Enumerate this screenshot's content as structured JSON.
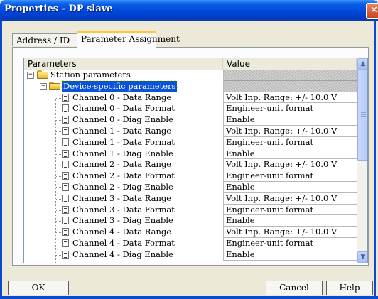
{
  "window": {
    "title": "Properties - DP slave"
  },
  "tabs": [
    {
      "label": "Address / ID",
      "active": false
    },
    {
      "label": "Parameter Assignment",
      "active": true
    }
  ],
  "grid": {
    "col_parameters": "Parameters",
    "col_value": "Value",
    "station_row": {
      "label": "Station parameters",
      "value": ""
    },
    "device_row": {
      "label": "Device-specific parameters",
      "value": ""
    },
    "rows": [
      {
        "label": "Channel 0 - Data Range",
        "value": "Volt Inp. Range: +/- 10.0 V"
      },
      {
        "label": "Channel 0 - Data Format",
        "value": "Engineer-unit format"
      },
      {
        "label": "Channel 0 - Diag Enable",
        "value": "Enable"
      },
      {
        "label": "Channel 1 - Data Range",
        "value": "Volt Inp. Range: +/- 10.0 V"
      },
      {
        "label": "Channel 1 - Data Format",
        "value": "Engineer-unit format"
      },
      {
        "label": "Channel 1 - Diag Enable",
        "value": "Enable"
      },
      {
        "label": "Channel 2 - Data Range",
        "value": "Volt Inp. Range: +/- 10.0 V"
      },
      {
        "label": "Channel 2 - Data Format",
        "value": "Engineer-unit format"
      },
      {
        "label": "Channel 2 - Diag Enable",
        "value": "Enable"
      },
      {
        "label": "Channel 3 - Data Range",
        "value": "Volt Inp. Range: +/- 10.0 V"
      },
      {
        "label": "Channel 3 - Data Format",
        "value": "Engineer-unit format"
      },
      {
        "label": "Channel 3 - Diag Enable",
        "value": "Enable"
      },
      {
        "label": "Channel 4 - Data Range",
        "value": "Volt Inp. Range: +/- 10.0 V"
      },
      {
        "label": "Channel 4 - Data Format",
        "value": "Engineer-unit format"
      },
      {
        "label": "Channel 4 - Diag Enable",
        "value": "Enable"
      }
    ]
  },
  "buttons": {
    "ok": "OK",
    "cancel": "Cancel",
    "help": "Help"
  },
  "colors": {
    "titlebar": "#0048d8",
    "selection": "#0a52d6",
    "dialog_bg": "#ece9d8"
  },
  "icons": {
    "close": "close-icon",
    "folder": "folder-icon",
    "param": "parameter-icon",
    "scroll_up": "chevron-up-icon",
    "scroll_down": "chevron-down-icon"
  }
}
